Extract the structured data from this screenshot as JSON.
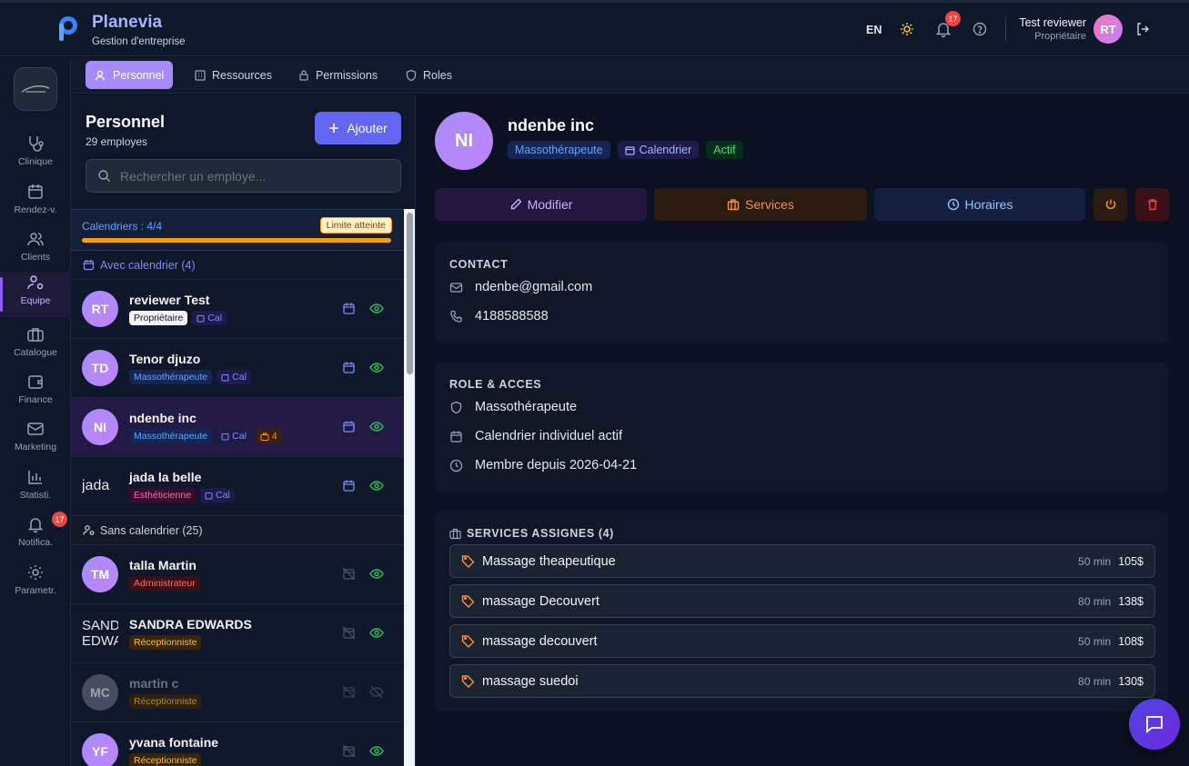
{
  "app": {
    "title": "Planevia",
    "subtitle": "Gestion d'entreprise"
  },
  "topbar": {
    "lang": "EN",
    "notif_count": "17",
    "user_name": "Test reviewer",
    "user_role": "Propriétaire",
    "user_initials": "RT"
  },
  "sidebar": {
    "items": [
      {
        "label": "Clinique",
        "icon": "stethoscope-icon"
      },
      {
        "label": "Rendez-v.",
        "icon": "calendar-icon"
      },
      {
        "label": "Clients",
        "icon": "users-icon"
      },
      {
        "label": "Equipe",
        "icon": "team-gear-icon"
      },
      {
        "label": "Catalogue",
        "icon": "briefcase-icon"
      },
      {
        "label": "Finance",
        "icon": "wallet-icon"
      },
      {
        "label": "Marketing",
        "icon": "mail-icon"
      },
      {
        "label": "Statisti.",
        "icon": "bar-chart-icon"
      },
      {
        "label": "Notifica.",
        "icon": "bell-icon",
        "badge": "17"
      },
      {
        "label": "Parametr.",
        "icon": "gear-icon"
      }
    ]
  },
  "tabs": [
    {
      "label": "Personnel"
    },
    {
      "label": "Ressources"
    },
    {
      "label": "Permissions"
    },
    {
      "label": "Roles"
    }
  ],
  "list": {
    "title": "Personnel",
    "count": "29 employes",
    "add_label": "Ajouter",
    "search_placeholder": "Rechercher un employe...",
    "quota_label": "Calendriers : 4/4",
    "quota_badge": "Limite atteinte",
    "quota_fill": 1.0,
    "group_with": "Avec calendrier (4)",
    "group_without": "Sans calendrier (25)",
    "employees_with": [
      {
        "initials": "RT",
        "name": "reviewer Test",
        "role": "Propriétaire",
        "cal": "Cal"
      },
      {
        "initials": "TD",
        "name": "Tenor djuzo",
        "role": "Massothérapeute",
        "cal": "Cal"
      },
      {
        "initials": "NI",
        "name": "ndenbe inc",
        "role": "Massothérapeute",
        "cal": "Cal",
        "services": "4"
      },
      {
        "initials": "jada",
        "name": "jada la belle",
        "role": "Esthéticienne",
        "cal": "Cal"
      }
    ],
    "employees_without": [
      {
        "initials": "TM",
        "name": "talla Martin",
        "role": "Administrateur"
      },
      {
        "initials": "SANDRA EDWARDS",
        "name": "SANDRA EDWARDS",
        "role": "Réceptionniste"
      },
      {
        "initials": "MC",
        "name": "martin c",
        "role": "Réceptionniste"
      },
      {
        "initials": "YF",
        "name": "yvana fontaine",
        "role": "Réceptionniste"
      }
    ]
  },
  "detail": {
    "initials": "NI",
    "name": "ndenbe inc",
    "role_tag": "Massothérapeute",
    "cal_tag": "Calendrier",
    "status_tag": "Actif",
    "btn_edit": "Modifier",
    "btn_services": "Services",
    "btn_hours": "Horaires",
    "contact_title": "CONTACT",
    "email": "ndenbe@gmail.com",
    "phone": "4188588588",
    "role_title": "ROLE & ACCES",
    "role": "Massothérapeute",
    "calendar_status": "Calendrier individuel actif",
    "member_since": "Membre depuis 2026-04-21",
    "services_title": "SERVICES ASSIGNES (4)",
    "services": [
      {
        "name": "Massage theapeutique",
        "duration": "50 min",
        "price": "105$"
      },
      {
        "name": "massage Decouvert",
        "duration": "80 min",
        "price": "138$"
      },
      {
        "name": "massage decouvert",
        "duration": "50 min",
        "price": "108$"
      },
      {
        "name": "massage suedoi",
        "duration": "80 min",
        "price": "130$"
      }
    ]
  },
  "colors": {
    "accent": "#a78bfa",
    "primary": "#6366f1",
    "warning": "#f59e0b",
    "success": "#4ade80",
    "danger": "#ef4444"
  }
}
